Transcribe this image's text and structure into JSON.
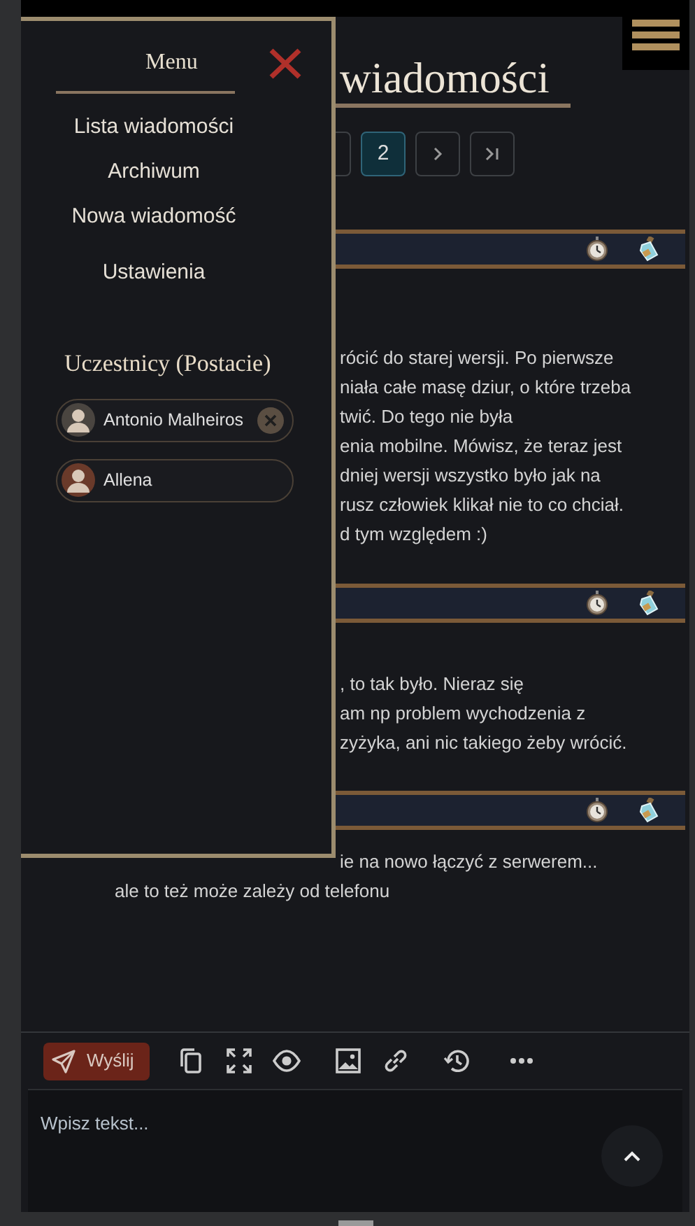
{
  "page_title": "wiadomości",
  "pagination": [
    {
      "kind": "page",
      "selected": false
    },
    {
      "kind": "page",
      "label": "2",
      "selected": true
    },
    {
      "kind": "next",
      "selected": false
    },
    {
      "kind": "last",
      "selected": false
    }
  ],
  "messages": [
    {
      "lines": [
        "rócić do starej wersji. Po pierwsze",
        "niała całe masę dziur, o które trzeba",
        "twić. Do tego nie była",
        "enia mobilne. Mówisz, że teraz jest",
        "dniej wersji wszystko było jak na",
        "rusz człowiek klikał nie to co chciał.",
        "d tym względem :)"
      ]
    },
    {
      "lines": [
        ", to tak było. Nieraz się",
        "am np problem wychodzenia z",
        "zyżyka, ani nic takiego żeby wrócić."
      ]
    },
    {
      "lines": [
        "ie na nowo łączyć z serwerem..."
      ],
      "continued_lines": [
        "ale to też może zależy od telefonu"
      ]
    }
  ],
  "menu": {
    "title": "Menu",
    "items": [
      {
        "label": "Lista wiadomości"
      },
      {
        "label": "Archiwum"
      },
      {
        "label": "Nowa wiadomość"
      },
      {
        "label": "Ustawienia"
      }
    ],
    "participants_heading": "Uczestnicy (Postacie)",
    "participants": [
      {
        "name": "Antonio Malheiros",
        "removable": true
      },
      {
        "name": "Allena",
        "removable": false
      }
    ]
  },
  "toolbar": {
    "send": "Wyślij",
    "tools": [
      {
        "kind": "copy"
      },
      {
        "kind": "fullscreen"
      },
      {
        "kind": "preview"
      },
      {
        "kind": "image"
      },
      {
        "kind": "link"
      },
      {
        "kind": "history"
      },
      {
        "kind": "more"
      }
    ]
  },
  "editor": {
    "placeholder": "Wpisz tekst..."
  }
}
